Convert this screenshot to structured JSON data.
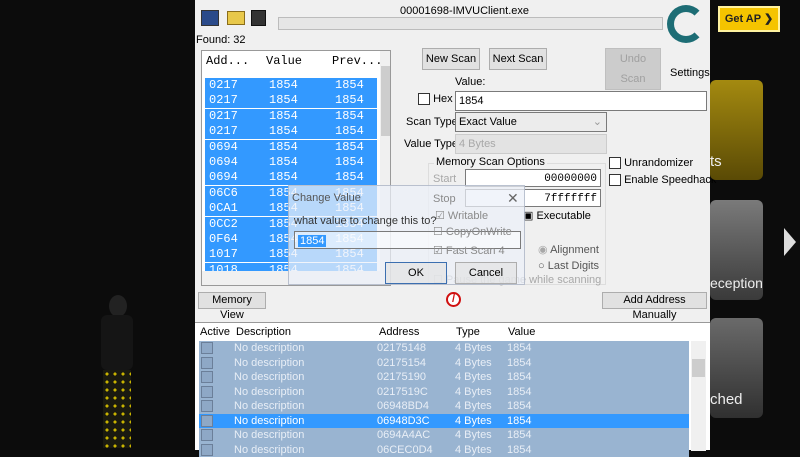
{
  "window": {
    "process_title": "00001698-IMVUClient.exe",
    "found_label": "Found: 32",
    "settings_label": "Settings"
  },
  "toolbar": {
    "open_process_icon": "computer-icon",
    "open_icon": "folder-open-icon",
    "save_icon": "floppy-disk-icon"
  },
  "scan_list": {
    "headers": [
      "Add...",
      "Value",
      "Prev..."
    ],
    "rows": [
      [
        "0217",
        "1854",
        "1854"
      ],
      [
        "0217",
        "1854",
        "1854"
      ],
      [
        "0217",
        "1854",
        "1854"
      ],
      [
        "0217",
        "1854",
        "1854"
      ],
      [
        "0694",
        "1854",
        "1854"
      ],
      [
        "0694",
        "1854",
        "1854"
      ],
      [
        "0694",
        "1854",
        "1854"
      ],
      [
        "06C6",
        "1854",
        "1854"
      ],
      [
        "0CA1",
        "1854",
        "1854"
      ],
      [
        "0CC2",
        "1854",
        "1854"
      ],
      [
        "0F64",
        "1854",
        "1854"
      ],
      [
        "1017",
        "1854",
        "1854"
      ],
      [
        "1018",
        "1854",
        "1854"
      ]
    ]
  },
  "scan": {
    "new_scan": "New Scan",
    "next_scan": "Next Scan",
    "undo_scan": "Undo Scan",
    "value_label": "Value:",
    "hex_label": "Hex",
    "value": "1854",
    "scan_type_label": "Scan Type",
    "scan_type": "Exact Value",
    "value_type_label": "Value Type",
    "value_type": "4 Bytes",
    "options_title": "Memory Scan Options",
    "start_label": "Start",
    "start_value": "00000000",
    "stop_label": "Stop",
    "stop_value": "7fffffff",
    "writable": "Writable",
    "executable": "Executable",
    "copy_on_write": "CopyOnWrite",
    "fast_scan": "Fast Scan",
    "fast_scan_value": "4",
    "alignment": "Alignment",
    "last_digits": "Last Digits",
    "pause_game": "Pause the game while scanning",
    "unrandomizer": "Unrandomizer",
    "speedhack": "Enable Speedhack"
  },
  "dialog": {
    "title": "Change Value",
    "prompt": "what value to change this to?",
    "value": "1854",
    "ok": "OK",
    "cancel": "Cancel"
  },
  "bottom_bar": {
    "memory_view": "Memory View",
    "add_address": "Add Address Manually"
  },
  "address_list": {
    "headers": [
      "Active",
      "Description",
      "Address",
      "Type",
      "Value"
    ],
    "rows": [
      [
        "No description",
        "02175148",
        "4 Bytes",
        "1854"
      ],
      [
        "No description",
        "02175154",
        "4 Bytes",
        "1854"
      ],
      [
        "No description",
        "02175190",
        "4 Bytes",
        "1854"
      ],
      [
        "No description",
        "0217519C",
        "4 Bytes",
        "1854"
      ],
      [
        "No description",
        "06948BD4",
        "4 Bytes",
        "1854"
      ],
      [
        "No description",
        "06948D3C",
        "4 Bytes",
        "1854"
      ],
      [
        "No description",
        "0694A4AC",
        "4 Bytes",
        "1854"
      ],
      [
        "No description",
        "06CEC0D4",
        "4 Bytes",
        "1854"
      ]
    ],
    "selected_index": 5
  },
  "game": {
    "get_ap": "Get AP",
    "tile1_label": "ts",
    "tile2_label": "eception",
    "tile3_label": "ched"
  },
  "colors": {
    "selection": "#3399ff",
    "list_bg": "#99b4d1",
    "get_ap": "#f5c400"
  }
}
